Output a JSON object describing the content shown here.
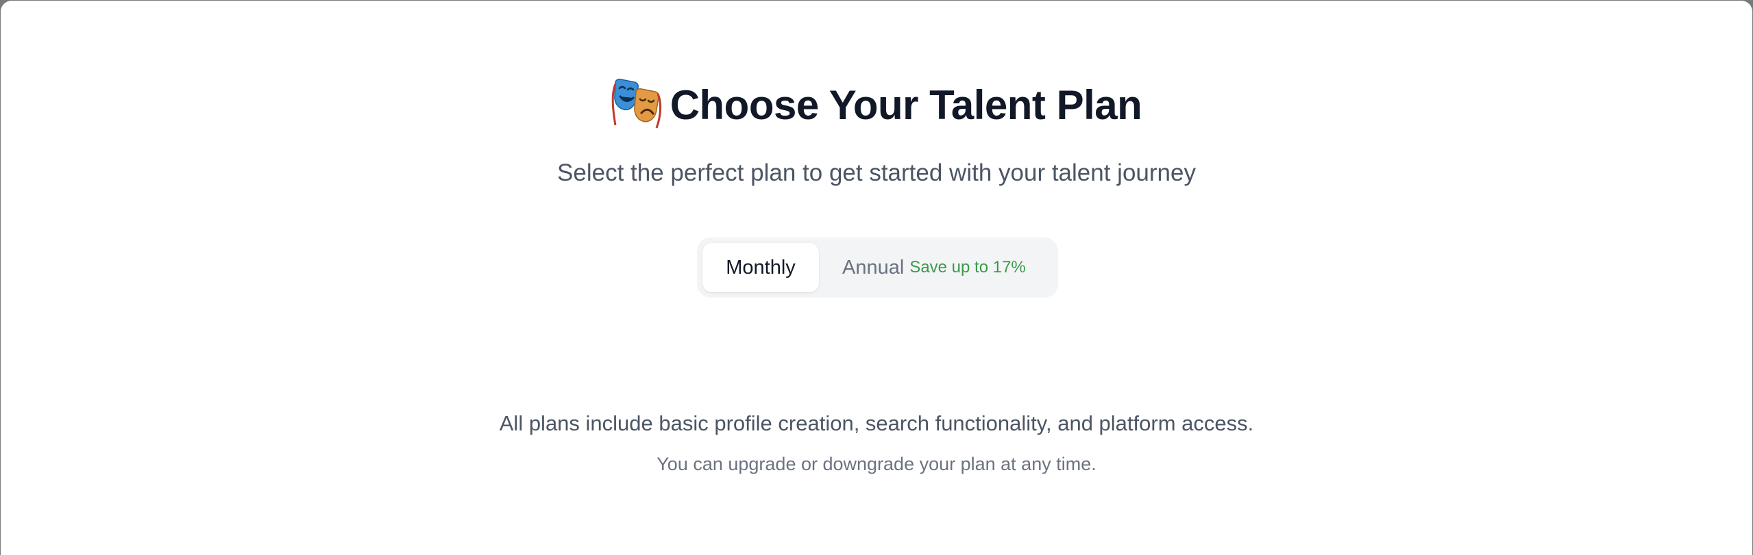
{
  "header": {
    "title_icon": "performing-arts-masks-icon",
    "title": "Choose Your Talent Plan",
    "subtitle": "Select the perfect plan to get started with your talent journey"
  },
  "billing_toggle": {
    "monthly_label": "Monthly",
    "annual_label": "Annual",
    "annual_badge": "Save up to 17%",
    "selected": "Monthly"
  },
  "footer": {
    "note": "All plans include basic profile creation, search functionality, and platform access.",
    "subnote": "You can upgrade or downgrade your plan at any time."
  },
  "colors": {
    "title": "#111827",
    "body_text": "#4b5563",
    "muted_text": "#6b7280",
    "toggle_bg": "#f3f4f6",
    "savings_green": "#3a9a4a"
  }
}
